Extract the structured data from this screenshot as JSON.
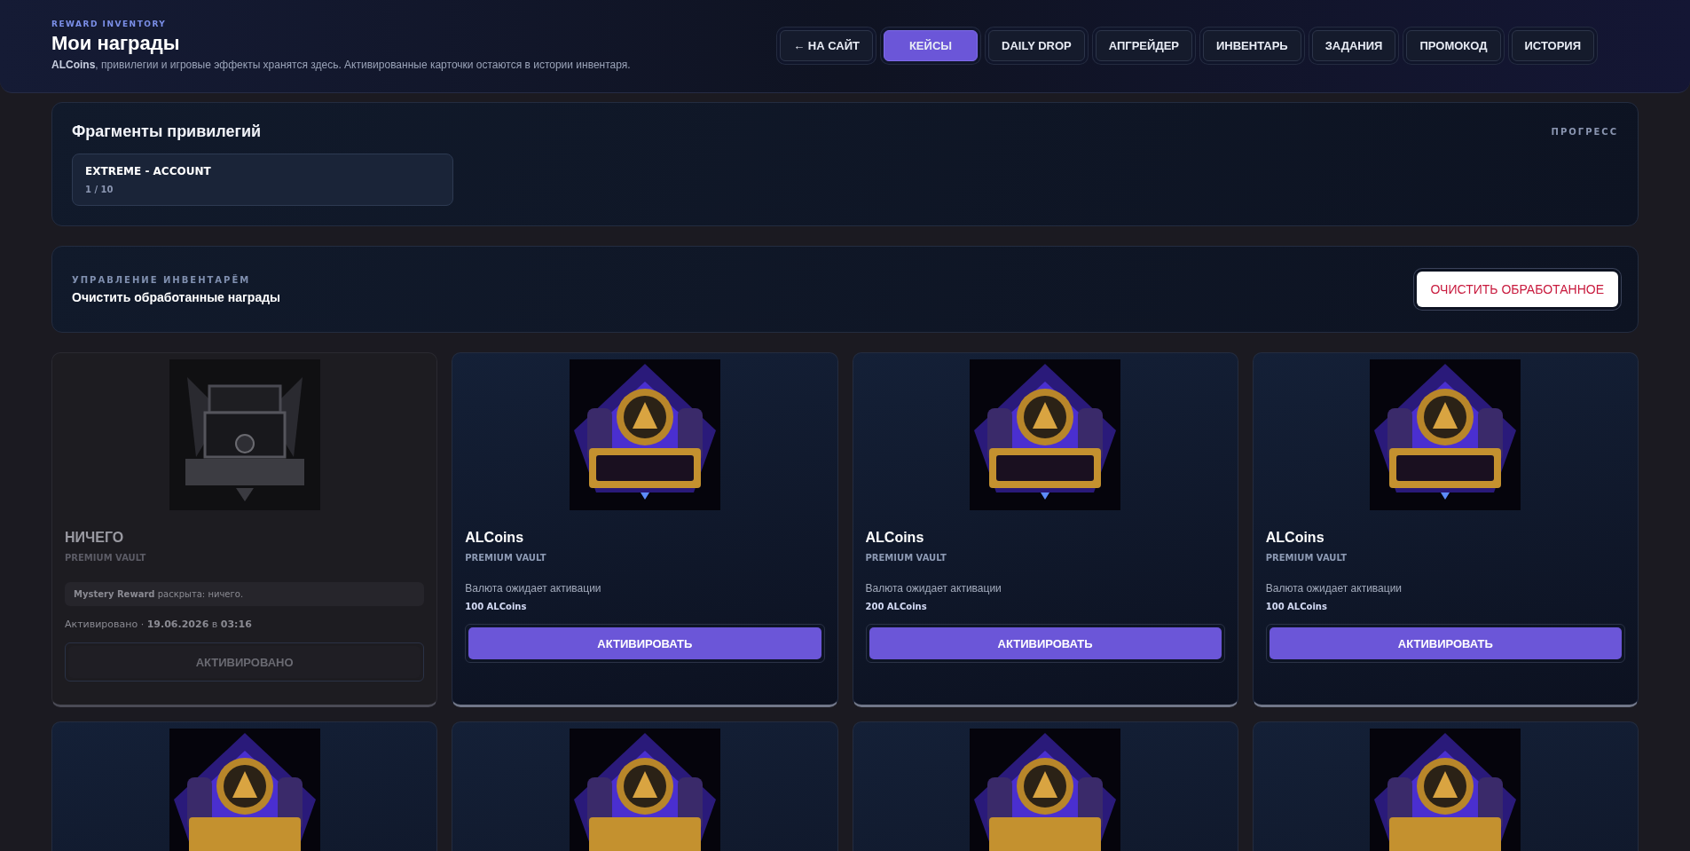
{
  "header": {
    "eyebrow": "REWARD INVENTORY",
    "title": "Мои награды",
    "subtitle": "**ALCoins**, привилегии и игровые эффекты хранятся здесь. Активированные карточки остаются в истории инвентаря."
  },
  "nav": [
    {
      "label": "← НА САЙТ",
      "selected": false
    },
    {
      "label": "КЕЙСЫ",
      "selected": true
    },
    {
      "label": "DAILY DROP",
      "selected": false
    },
    {
      "label": "АПГРЕЙДЕР",
      "selected": false
    },
    {
      "label": "ИНВЕНТАРЬ",
      "selected": false
    },
    {
      "label": "ЗАДАНИЯ",
      "selected": false
    },
    {
      "label": "ПРОМОКОД",
      "selected": false
    },
    {
      "label": "ИСТОРИЯ",
      "selected": false
    }
  ],
  "fragments": {
    "title": "Фрагменты привилегий",
    "progress_label": "ПРОГРЕСС",
    "items": [
      {
        "name": "EXTREME - ACCOUNT",
        "count": "1 / 10"
      }
    ]
  },
  "management": {
    "eyebrow": "УПРАВЛЕНИЕ ИНВЕНТАРЁМ",
    "title": "Очистить обработанные награды",
    "button": "ОЧИСТИТЬ ОБРАБОТАННОЕ"
  },
  "cards": [
    {
      "activated": true,
      "title": "НИЧЕГО",
      "source": "PREMIUM VAULT",
      "note": "**Mystery Reward** раскрыта: ничего.",
      "activated_at": "Активировано · **19.06.2026** в **03:16**",
      "button": "АКТИВИРОВАНО"
    },
    {
      "activated": false,
      "title": "ALCoins",
      "source": "PREMIUM VAULT",
      "description": "Валюта ожидает активации",
      "amount": "100 ALCoins",
      "button": "АКТИВИРОВАТЬ"
    },
    {
      "activated": false,
      "title": "ALCoins",
      "source": "PREMIUM VAULT",
      "description": "Валюта ожидает активации",
      "amount": "200 ALCoins",
      "button": "АКТИВИРОВАТЬ"
    },
    {
      "activated": false,
      "title": "ALCoins",
      "source": "PREMIUM VAULT",
      "description": "Валюта ожидает активации",
      "amount": "100 ALCoins",
      "button": "АКТИВИРОВАТЬ"
    }
  ]
}
